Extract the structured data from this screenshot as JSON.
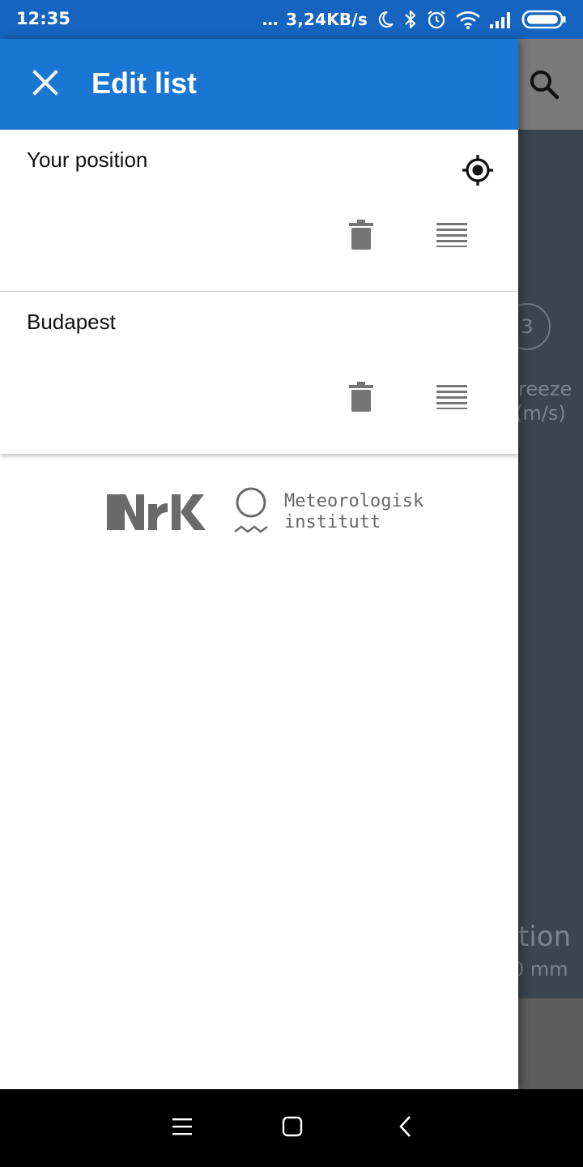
{
  "status_bar": {
    "time": "12:35",
    "dots": "...",
    "net_speed": "3,24KB/s",
    "icons": [
      "moon-icon",
      "bluetooth-icon",
      "alarm-icon",
      "wifi-icon",
      "signal-icon",
      "battery-icon"
    ]
  },
  "background_app": {
    "icons": [
      "search-icon"
    ],
    "wind_value": "3",
    "wind_label_1": "reeze",
    "wind_label_2": "(m/s)",
    "precip_label": "tion",
    "precip_value": "0 mm"
  },
  "drawer": {
    "title": "Edit list",
    "close_icon": "close-icon",
    "items": [
      {
        "name": "Your position",
        "has_locate": true,
        "icons": [
          "gps-target-icon",
          "delete-icon",
          "drag-handle-icon"
        ]
      },
      {
        "name": "Budapest",
        "has_locate": false,
        "icons": [
          "delete-icon",
          "drag-handle-icon"
        ]
      }
    ],
    "logos": {
      "nrk": "NRK",
      "met_line1": "Meteorologisk",
      "met_line2": "institutt"
    }
  },
  "nav_bar": {
    "icons": [
      "menu-icon",
      "home-icon",
      "back-icon"
    ]
  },
  "colors": {
    "status_bar": "#1565c0",
    "toolbar": "#1976d2",
    "icon_gray": "#757575",
    "background_app": "#434c57"
  }
}
